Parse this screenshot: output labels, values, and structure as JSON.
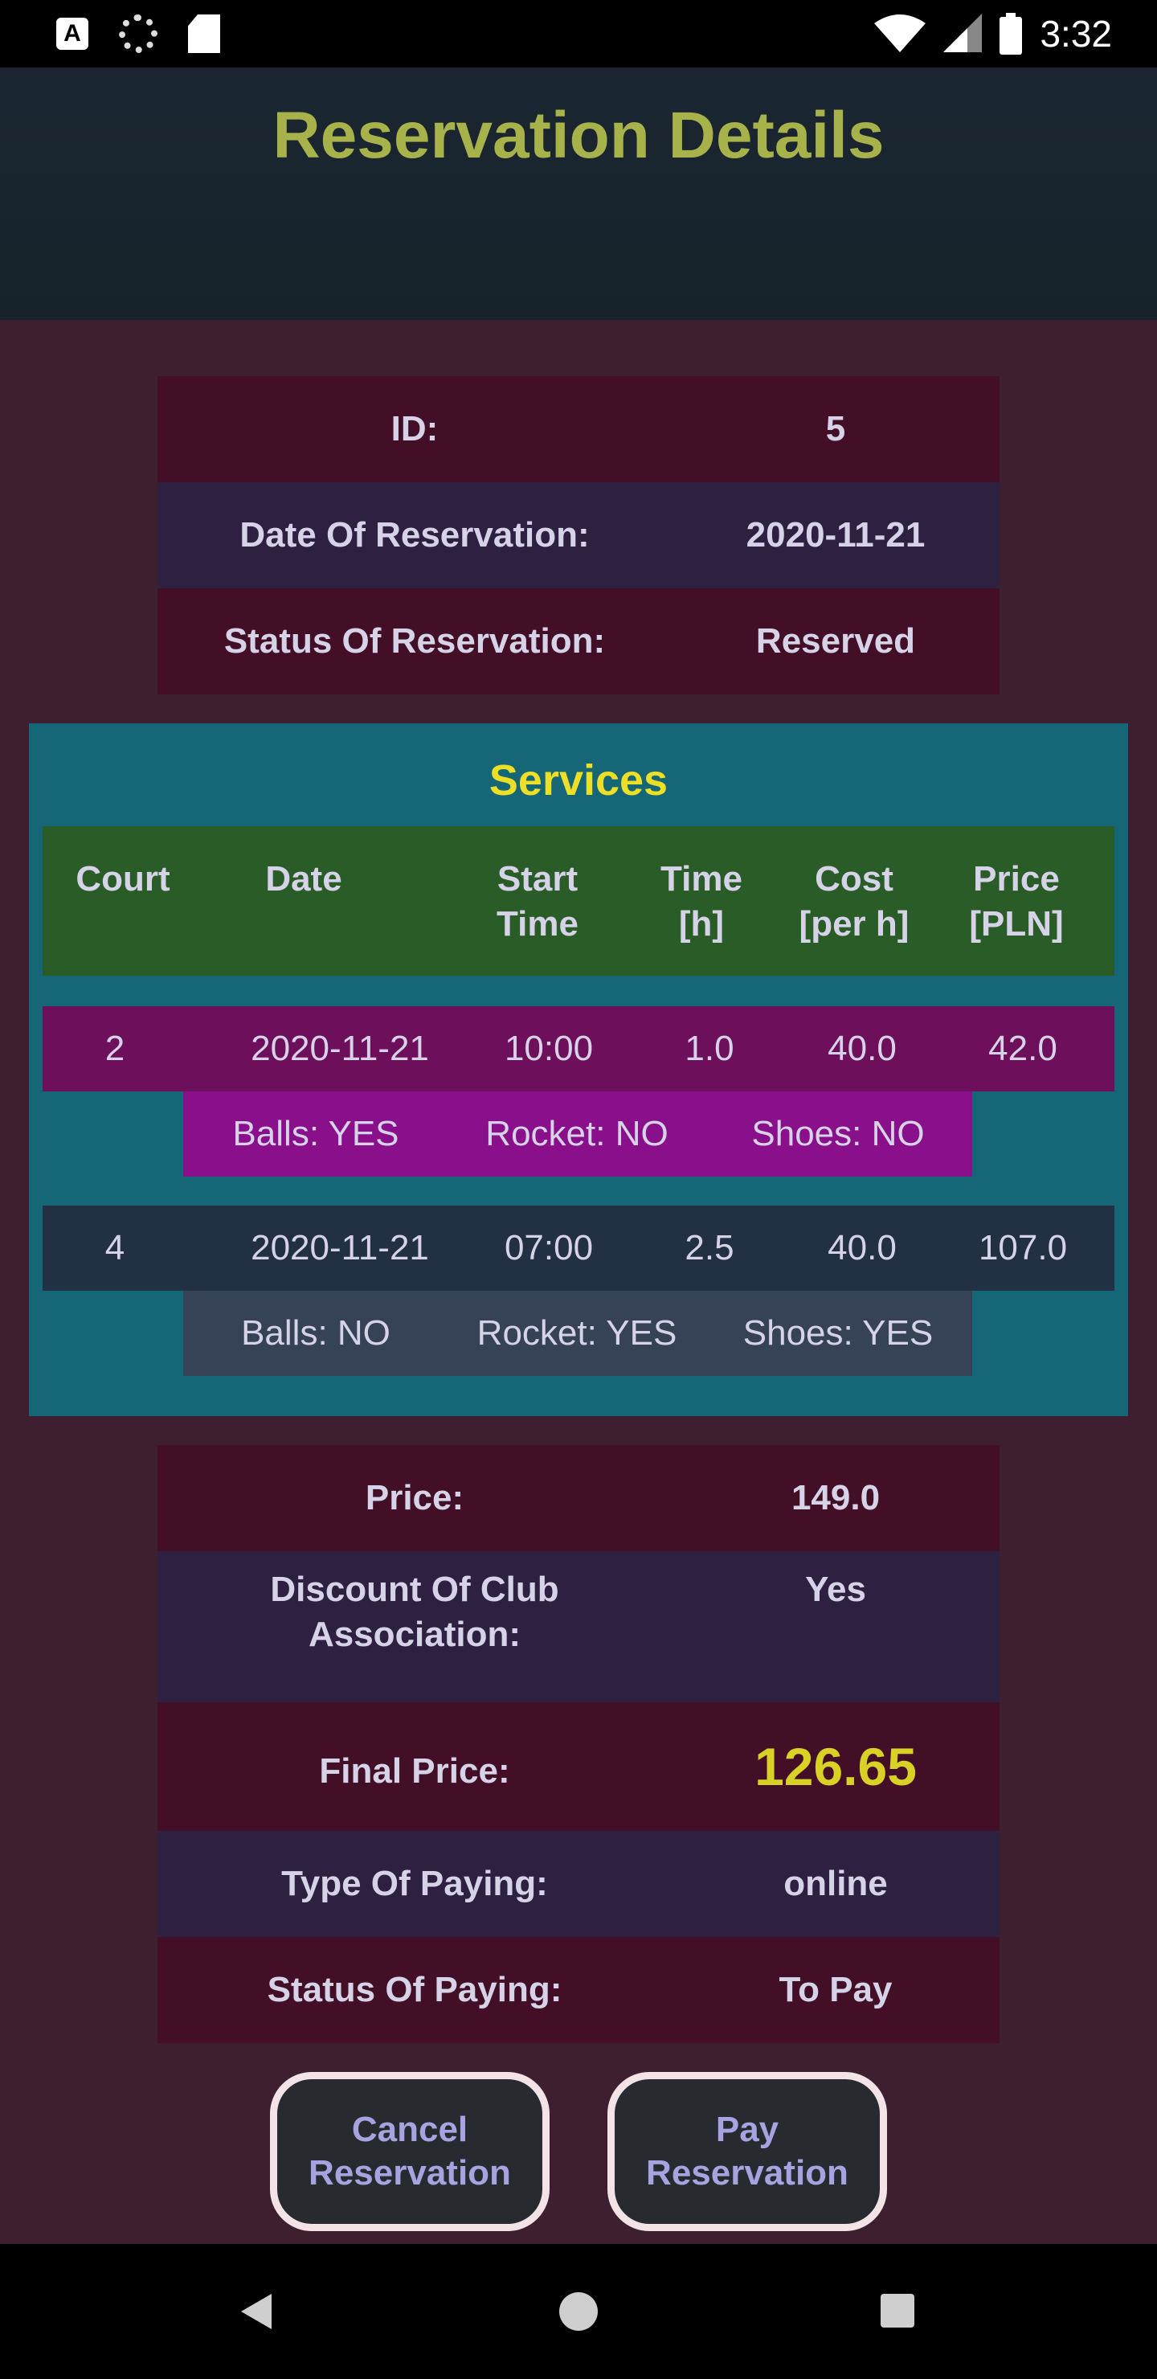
{
  "status_bar": {
    "time": "3:32",
    "icons": [
      "text-a-icon",
      "loading-icon",
      "sd-card-icon",
      "wifi-icon",
      "signal-icon",
      "battery-icon"
    ]
  },
  "header": {
    "title": "Reservation Details"
  },
  "reservation": [
    {
      "label": "ID:",
      "value": "5"
    },
    {
      "label": "Date Of Reservation:",
      "value": "2020-11-21"
    },
    {
      "label": "Status Of Reservation:",
      "value": "Reserved"
    }
  ],
  "services": {
    "title": "Services",
    "columns": [
      "Court",
      "Date",
      "Start\nTime",
      "Time\n[h]",
      "Cost\n[per h]",
      "Price\n[PLN]"
    ],
    "rows": [
      {
        "court": "2",
        "date": "2020-11-21",
        "start": "10:00",
        "time": "1.0",
        "cost": "40.0",
        "price": "42.0",
        "balls": "Balls: YES",
        "rocket": "Rocket: NO",
        "shoes": "Shoes: NO"
      },
      {
        "court": "4",
        "date": "2020-11-21",
        "start": "07:00",
        "time": "2.5",
        "cost": "40.0",
        "price": "107.0",
        "balls": "Balls: NO",
        "rocket": "Rocket: YES",
        "shoes": "Shoes: YES"
      }
    ]
  },
  "summary": [
    {
      "label": "Price:",
      "value": "149.0"
    },
    {
      "label": "Discount Of Club Association:",
      "value": "Yes"
    },
    {
      "label": "Final Price:",
      "value": "126.65"
    },
    {
      "label": "Type Of Paying:",
      "value": "online"
    },
    {
      "label": "Status Of Paying:",
      "value": "To Pay"
    }
  ],
  "buttons": {
    "cancel": "Cancel\nReservation",
    "pay": "Pay\nReservation"
  },
  "colors": {
    "background": "#3d1f30",
    "header": "#1b2632",
    "title": "#a8b24a",
    "row_dark": "#420f26",
    "row_purple": "#2d2040",
    "services_bg": "#156778",
    "services_head": "#2a5c27",
    "service_row_1": "#6e0f5c",
    "service_row_1_extra": "#8a0f8a",
    "service_row_2": "#223044",
    "service_row_2_extra": "#364357",
    "highlight": "#d9d126"
  }
}
